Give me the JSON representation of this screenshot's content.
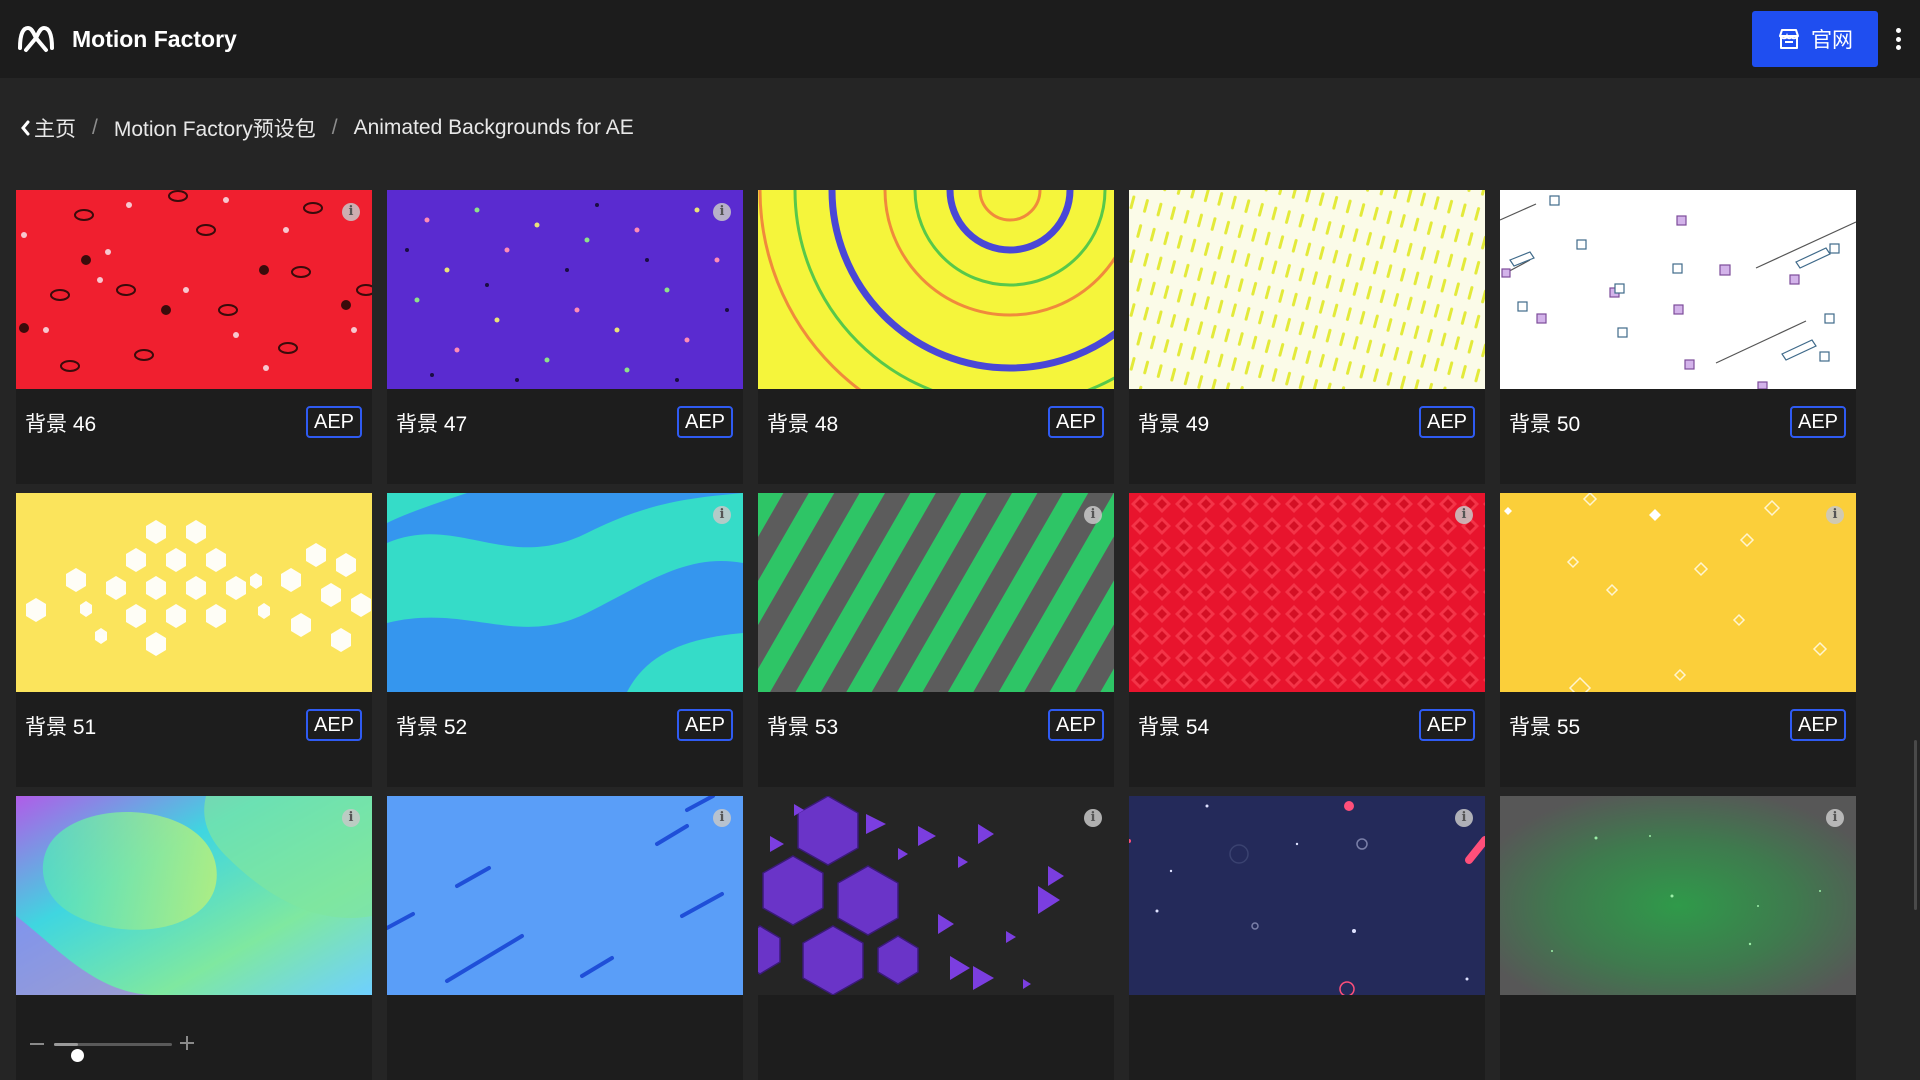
{
  "header": {
    "app_title": "Motion Factory",
    "site_button_label": "官网",
    "logo_icon": "motion-factory-logo",
    "site_button_icon": "storefront-icon",
    "more_icon": "vertical-dots-icon",
    "accent_color": "#1f4ef0"
  },
  "breadcrumb": {
    "items": [
      "主页",
      "Motion Factory预设包",
      "Animated Backgrounds for AE"
    ],
    "separator": "/",
    "back_icon": "chevron-left-icon"
  },
  "items": [
    {
      "title": "背景 46",
      "format": "AEP",
      "thumbnail": "red-lips-pattern"
    },
    {
      "title": "背景 47",
      "format": "AEP",
      "thumbnail": "purple-confetti-dots"
    },
    {
      "title": "背景 48",
      "format": "AEP",
      "thumbnail": "yellow-concentric-rings"
    },
    {
      "title": "背景 49",
      "format": "AEP",
      "thumbnail": "yellow-dashes-on-white"
    },
    {
      "title": "背景 50",
      "format": "AEP",
      "thumbnail": "white-isometric-cubes"
    },
    {
      "title": "背景 51",
      "format": "AEP",
      "thumbnail": "yellow-hexagons"
    },
    {
      "title": "背景 52",
      "format": "AEP",
      "thumbnail": "blue-teal-waves"
    },
    {
      "title": "背景 53",
      "format": "AEP",
      "thumbnail": "green-grey-stripes"
    },
    {
      "title": "背景 54",
      "format": "AEP",
      "thumbnail": "red-diamond-pattern"
    },
    {
      "title": "背景 55",
      "format": "AEP",
      "thumbnail": "yellow-floating-diamonds"
    },
    {
      "title": "",
      "format": "",
      "thumbnail": "gradient-fluid-blobs"
    },
    {
      "title": "",
      "format": "",
      "thumbnail": "blue-diagonal-dashes"
    },
    {
      "title": "",
      "format": "",
      "thumbnail": "purple-hexagon-triangles"
    },
    {
      "title": "",
      "format": "",
      "thumbnail": "navy-circles-particles"
    },
    {
      "title": "",
      "format": "",
      "thumbnail": "grey-green-glow"
    }
  ],
  "zoom": {
    "level": 0.2
  }
}
